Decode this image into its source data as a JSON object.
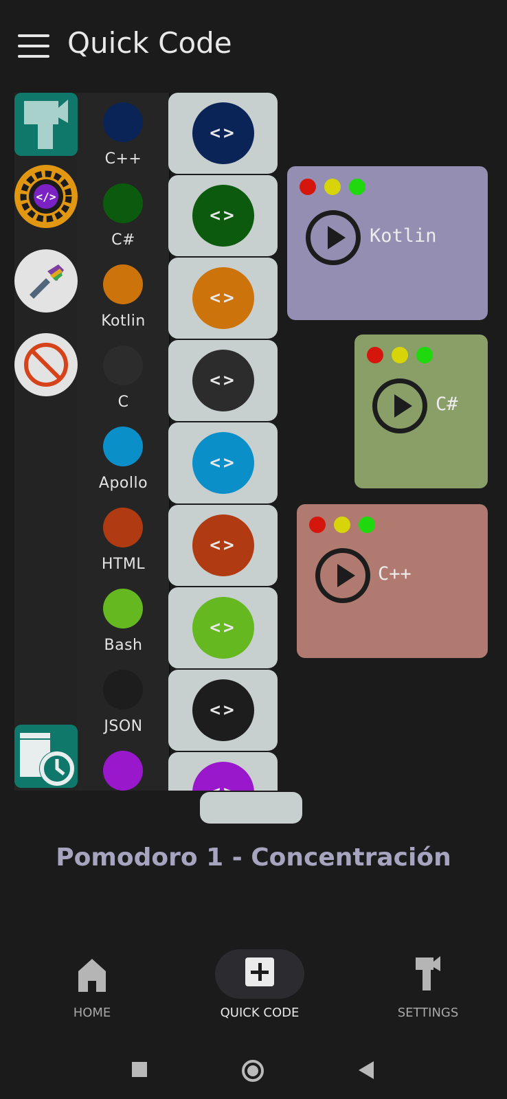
{
  "app": {
    "title": "Quick Code"
  },
  "languages": [
    {
      "label": "C++",
      "color": "#0a2457"
    },
    {
      "label": "C#",
      "color": "#0b5a0e"
    },
    {
      "label": "Kotlin",
      "color": "#cc740b"
    },
    {
      "label": "C",
      "color": "#2c2c2c"
    },
    {
      "label": "Apollo",
      "color": "#0a8fc8"
    },
    {
      "label": "HTML",
      "color": "#b03a12"
    },
    {
      "label": "Bash",
      "color": "#66b821"
    },
    {
      "label": "JSON",
      "color": "#1d1d1d"
    },
    {
      "label": "",
      "color": "#9a18cc"
    }
  ],
  "code_button": {
    "glyph": "<>"
  },
  "windows": [
    {
      "label": "Kotlin",
      "color": "#938eb2"
    },
    {
      "label": "C#",
      "color": "#8a9e68"
    },
    {
      "label": "C++",
      "color": "#b07a70"
    }
  ],
  "window_dot_colors": [
    "#d4160c",
    "#d7d40a",
    "#1fd90e"
  ],
  "timer": {
    "label": "Pomodoro 1 - Concentración"
  },
  "nav": {
    "home": "HOME",
    "quick_code": "QUICK CODE",
    "settings": "SETTINGS"
  }
}
